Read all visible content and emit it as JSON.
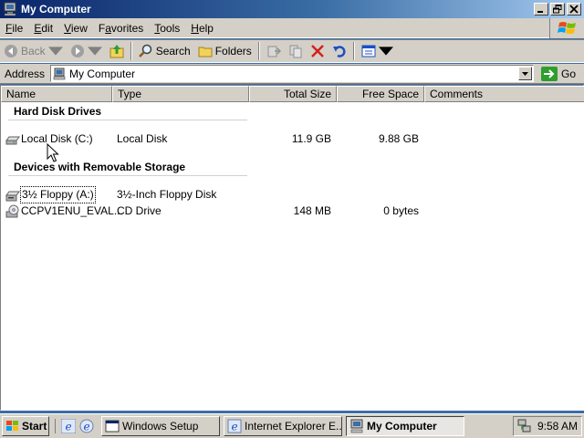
{
  "window": {
    "title": "My Computer"
  },
  "menu": [
    {
      "pre": "",
      "ul": "F",
      "post": "ile"
    },
    {
      "pre": "",
      "ul": "E",
      "post": "dit"
    },
    {
      "pre": "",
      "ul": "V",
      "post": "iew"
    },
    {
      "pre": "F",
      "ul": "a",
      "post": "vorites"
    },
    {
      "pre": "",
      "ul": "T",
      "post": "ools"
    },
    {
      "pre": "",
      "ul": "H",
      "post": "elp"
    }
  ],
  "toolbar": {
    "back": "Back",
    "search": "Search",
    "folders": "Folders"
  },
  "address": {
    "label": "Address",
    "value": "My Computer",
    "go": "Go"
  },
  "columns": {
    "name": "Name",
    "type": "Type",
    "total": "Total Size",
    "free": "Free Space",
    "comments": "Comments"
  },
  "groups": [
    {
      "title": "Hard Disk Drives",
      "items": [
        {
          "name": "Local Disk (C:)",
          "type": "Local Disk",
          "total": "11.9 GB",
          "free": "9.88 GB",
          "icon": "hard-disk-icon"
        }
      ]
    },
    {
      "title": "Devices with Removable Storage",
      "items": [
        {
          "name": "3½ Floppy (A:)",
          "type": "3½-Inch Floppy Disk",
          "total": "",
          "free": "",
          "icon": "floppy-drive-icon"
        },
        {
          "name": "CCPV1ENU_EVAL...",
          "type": "CD Drive",
          "total": "148 MB",
          "free": "0 bytes",
          "icon": "cd-drive-icon"
        }
      ]
    }
  ],
  "taskbar": {
    "start": "Start",
    "tasks": [
      {
        "label": "Windows Setup",
        "active": false
      },
      {
        "label": "Internet Explorer E...",
        "active": false
      },
      {
        "label": "My Computer",
        "active": true
      }
    ],
    "clock": "9:58 AM"
  }
}
